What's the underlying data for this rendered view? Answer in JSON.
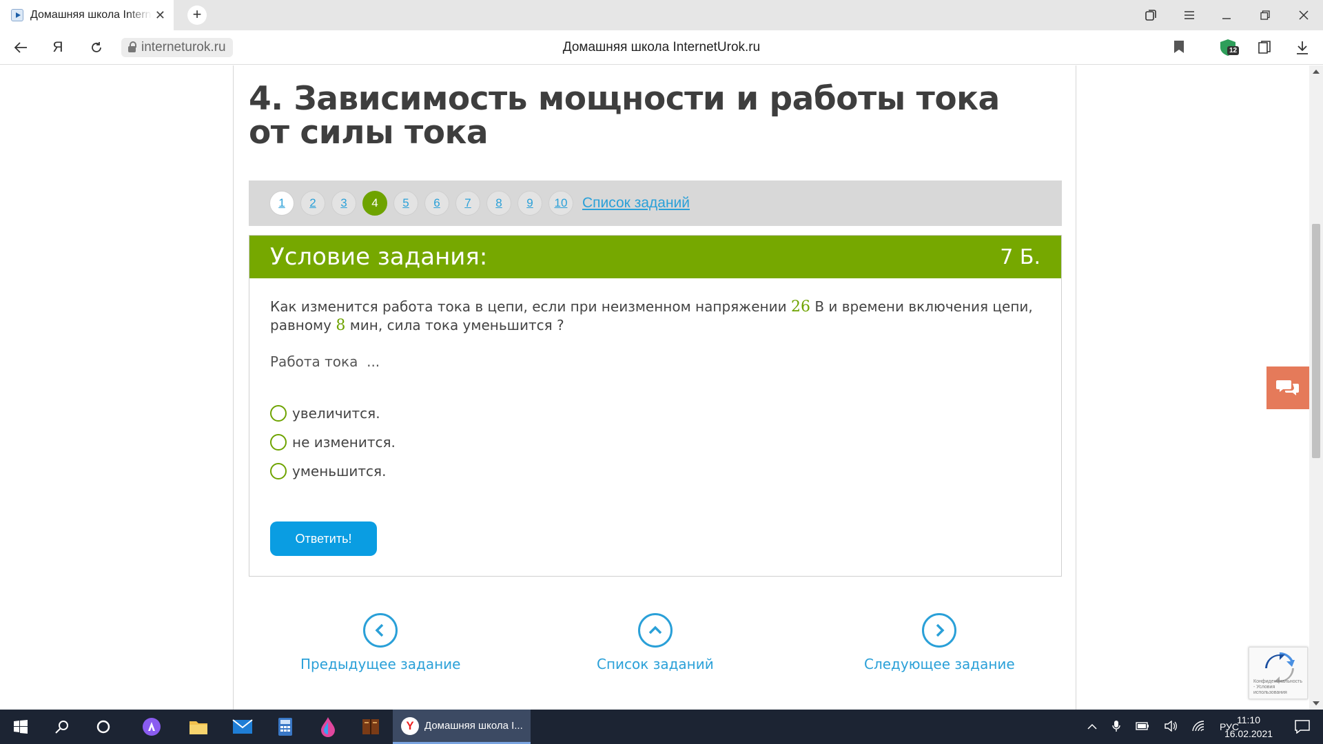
{
  "browser": {
    "tab_title": "Домашняя школа InternetUrok.ru",
    "url": "interneturok.ru",
    "page_heading": "Домашняя школа InternetUrok.ru",
    "extension_badge": "12"
  },
  "lesson": {
    "title": "4. Зависимость мощности и работы тока от силы тока"
  },
  "pager": {
    "pages": [
      "1",
      "2",
      "3",
      "4",
      "5",
      "6",
      "7",
      "8",
      "9",
      "10"
    ],
    "active_index": 3,
    "list_link": "Список заданий"
  },
  "task": {
    "header": "Условие задания:",
    "points": "7 Б.",
    "question": {
      "part1": "Как изменится работа тока в цепи, если при неизменном напряжении",
      "voltage": "26",
      "part2": "В и времени включения цепи, равному",
      "time": "8",
      "part3": "мин, сила тока уменьшится ?"
    },
    "subprompt": "Работа тока  ...",
    "options": [
      "увеличится.",
      "не изменится.",
      "уменьшится."
    ],
    "answer_button": "Ответить!"
  },
  "navigation": {
    "prev": "Предыдущее задание",
    "list": "Список заданий",
    "next": "Следующее задание"
  },
  "recaptcha": {
    "text": "Конфиденциальность - Условия использования"
  },
  "taskbar": {
    "active_app": "Домашняя школа I...",
    "language": "РУС",
    "time": "11:10",
    "date": "16.02.2021"
  },
  "colors": {
    "accent_green": "#76a800",
    "link_blue": "#2aa0d8",
    "button_blue": "#0a9de2",
    "chat_orange": "#e57a5a"
  }
}
